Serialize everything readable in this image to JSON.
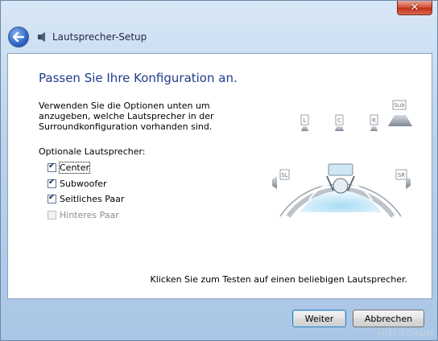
{
  "window": {
    "title": "Lautsprecher-Setup",
    "close_symbol": "✕"
  },
  "content": {
    "heading": "Passen Sie Ihre Konfiguration an.",
    "description": "Verwenden Sie die Optionen unten um anzugeben, welche Lautsprecher in der Surroundkonfiguration vorhanden sind.",
    "optional_title": "Optionale Lautsprecher:",
    "options": [
      {
        "label": "Center",
        "checked": true,
        "enabled": true
      },
      {
        "label": "Subwoofer",
        "checked": true,
        "enabled": true
      },
      {
        "label": "Seitliches Paar",
        "checked": true,
        "enabled": true
      },
      {
        "label": "Hinteres Paar",
        "checked": false,
        "enabled": false
      }
    ],
    "hint": "Klicken Sie zum Testen auf einen beliebigen Lautsprecher."
  },
  "diagram": {
    "labels": {
      "left": "L",
      "center": "C",
      "right": "R",
      "sub": "Sub",
      "side_left": "SL",
      "side_right": "SR"
    }
  },
  "footer": {
    "next_label": "Weiter",
    "cancel_label": "Abbrechen"
  },
  "watermark": "HIFI-FORUM"
}
